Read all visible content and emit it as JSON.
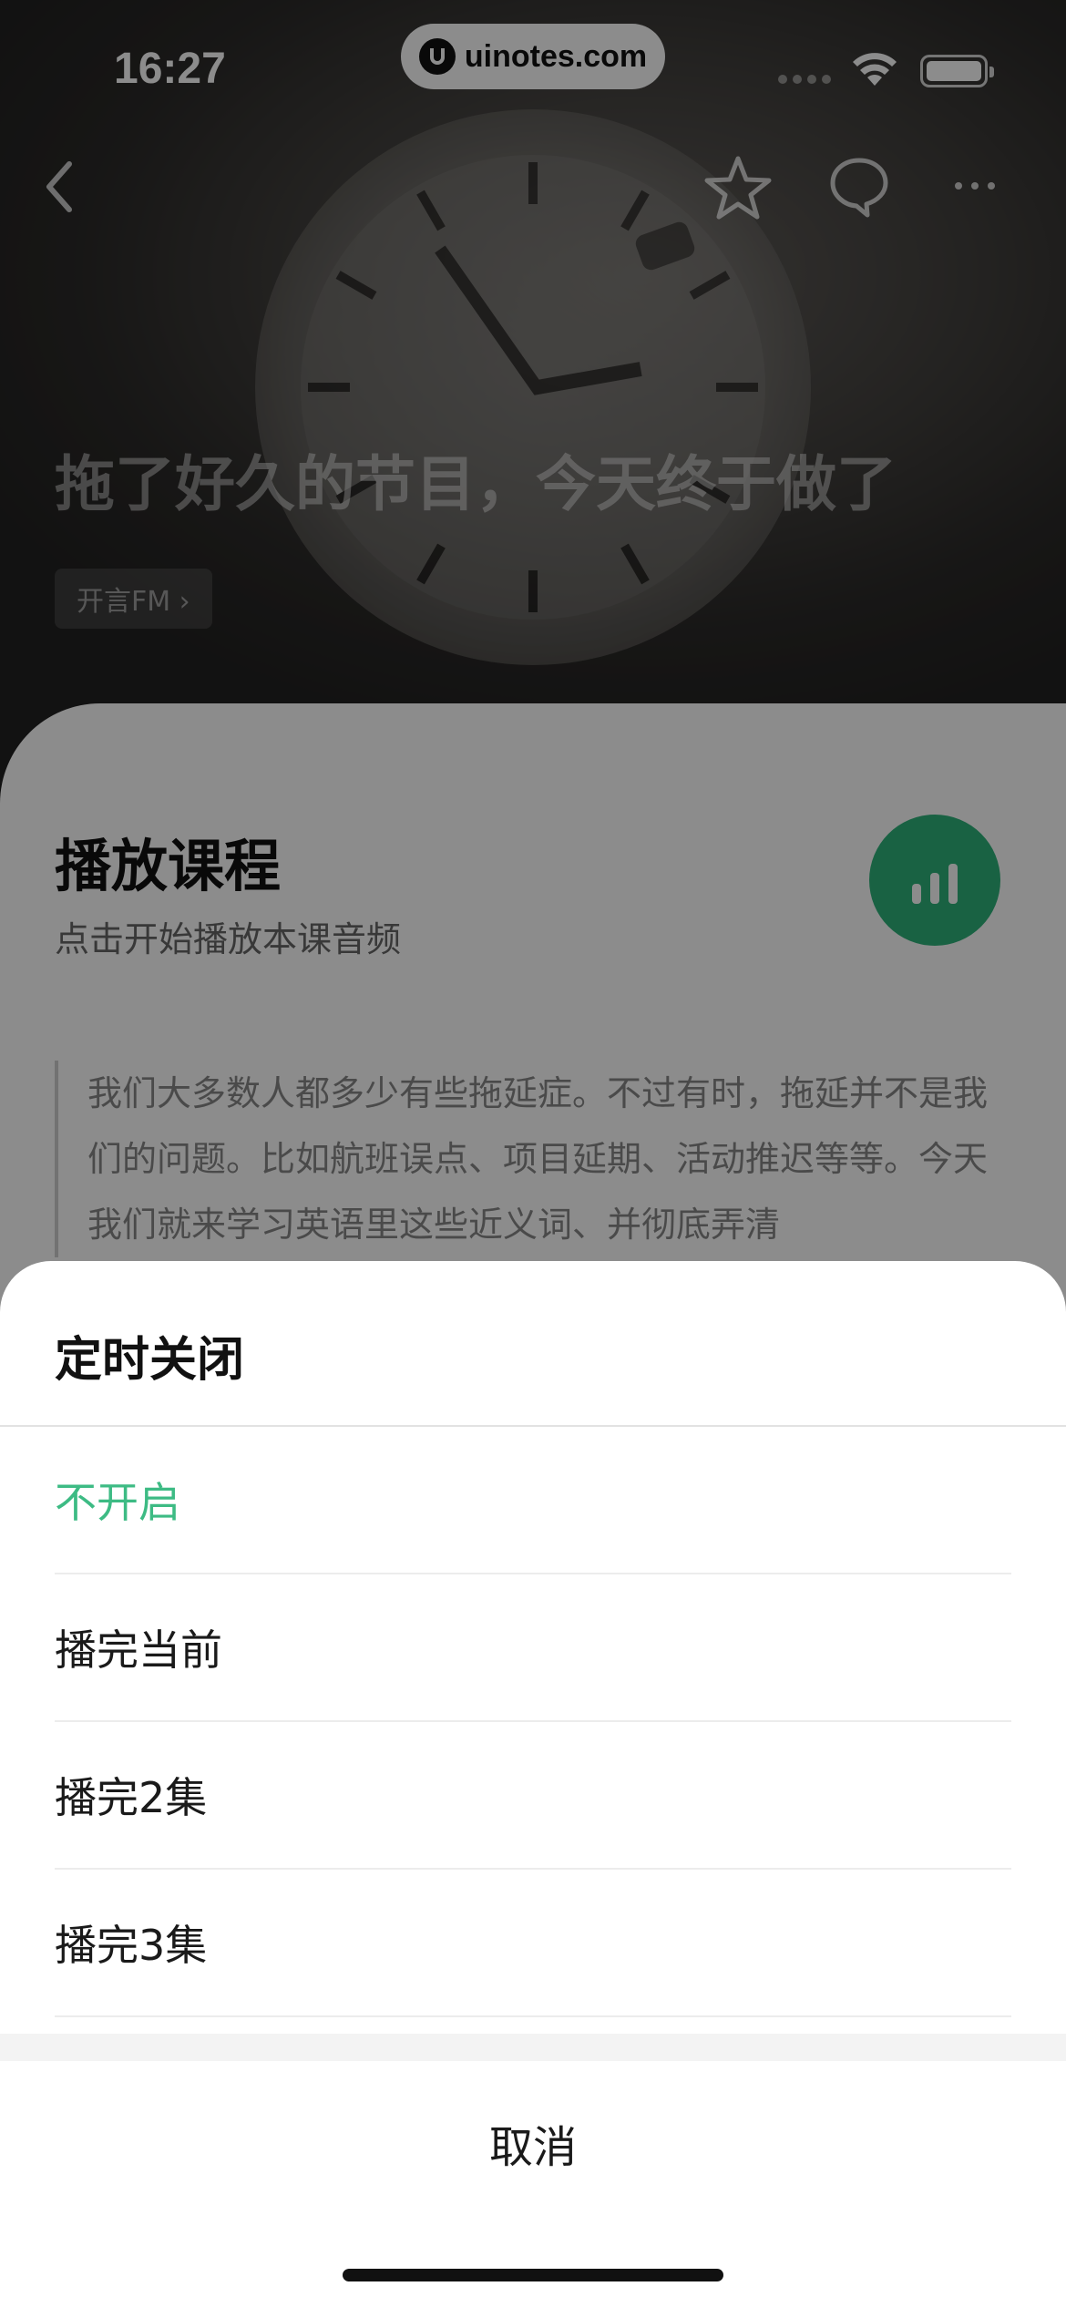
{
  "status_bar": {
    "time": "16:27",
    "url": "uinotes.com"
  },
  "hero": {
    "title": "拖了好久的节目，今天终于做了",
    "channel": "开言FM ›"
  },
  "course": {
    "title": "播放课程",
    "subtitle": "点击开始播放本课音频",
    "description": "我们大多数人都多少有些拖延症。不过有时，拖延并不是我们的问题。比如航班误点、项目延期、活动推迟等等。今天我们就来学习英语里这些近义词、并彻底弄清"
  },
  "sheet": {
    "title": "定时关闭",
    "options": [
      {
        "label": "不开启",
        "selected": true
      },
      {
        "label": "播完当前",
        "selected": false
      },
      {
        "label": "播完2集",
        "selected": false
      },
      {
        "label": "播完3集",
        "selected": false
      }
    ],
    "cancel": "取消"
  },
  "colors": {
    "accent": "#3dbb84",
    "play_button": "#2fb27a"
  },
  "icons": {
    "back": "chevron-left-icon",
    "favorite": "star-icon",
    "comment": "comment-icon",
    "more": "more-icon",
    "play": "audio-bars-icon"
  }
}
